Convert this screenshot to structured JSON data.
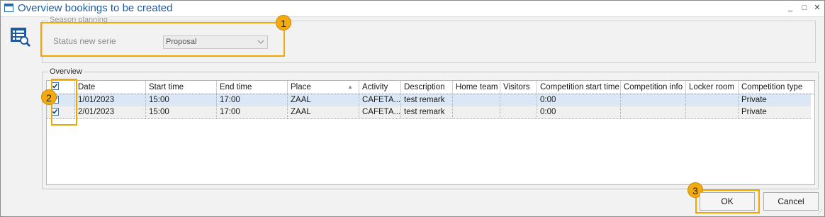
{
  "window": {
    "title": "Overview bookings to be created",
    "minimize_glyph": "_",
    "maximize_glyph": "□",
    "close_glyph": "✕"
  },
  "season": {
    "legend": "Season planning",
    "status_label": "Status new serie",
    "status_value": "Proposal"
  },
  "overview": {
    "legend": "Overview",
    "columns": [
      "Date",
      "Start time",
      "End time",
      "Place",
      "Activity",
      "Description",
      "Home team",
      "Visitors",
      "Competition start time",
      "Competition info",
      "Locker room",
      "Competition type"
    ],
    "header_checked": true,
    "rows": [
      {
        "checked": true,
        "date": "1/01/2023",
        "start": "15:00",
        "end": "17:00",
        "place": "ZAAL",
        "activity": "CAFETA...",
        "description": "test remark",
        "home": "",
        "visitors": "",
        "comp_start": "0:00",
        "comp_info": "",
        "locker": "",
        "comp_type": "Private"
      },
      {
        "checked": true,
        "date": "2/01/2023",
        "start": "15:00",
        "end": "17:00",
        "place": "ZAAL",
        "activity": "CAFETA...",
        "description": "test remark",
        "home": "",
        "visitors": "",
        "comp_start": "0:00",
        "comp_info": "",
        "locker": "",
        "comp_type": "Private"
      }
    ],
    "sorted_column": "Place"
  },
  "buttons": {
    "ok": "OK",
    "cancel": "Cancel"
  },
  "callouts": [
    "1",
    "2",
    "3"
  ],
  "colors": {
    "accent": "#1c5a9e",
    "callout": "#f3aa10",
    "selected_row": "#dbe7f5"
  }
}
